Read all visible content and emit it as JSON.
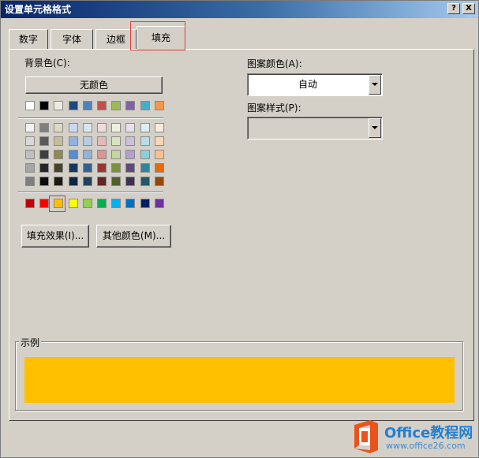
{
  "window": {
    "title": "设置单元格格式",
    "help_button": "?",
    "close_button": "X"
  },
  "tabs": [
    {
      "label": "数字",
      "active": false
    },
    {
      "label": "字体",
      "active": false
    },
    {
      "label": "边框",
      "active": false
    },
    {
      "label": "填充",
      "active": true
    }
  ],
  "background_color": {
    "label": "背景色(C):",
    "no_color_button": "无颜色",
    "theme_row": [
      "#ffffff",
      "#000000",
      "#eeece1",
      "#1f497d",
      "#4f81bd",
      "#c0504d",
      "#9bbb59",
      "#8064a2",
      "#4bacc6",
      "#f79646"
    ],
    "theme_shades": [
      [
        "#f2f2f2",
        "#7f7f7f",
        "#ddd9c3",
        "#c6d9f0",
        "#dbe5f1",
        "#f2dcdb",
        "#ebf1dd",
        "#e5e0ec",
        "#dbeef3",
        "#fdeada"
      ],
      [
        "#d8d8d8",
        "#595959",
        "#c4bd97",
        "#8db3e2",
        "#b8cce4",
        "#e5b9b7",
        "#d7e3bc",
        "#ccc1d9",
        "#b7dde8",
        "#fbd5b5"
      ],
      [
        "#bfbfbf",
        "#3f3f3f",
        "#938953",
        "#548dd4",
        "#95b3d7",
        "#d99694",
        "#c3d69b",
        "#b2a2c7",
        "#92cddc",
        "#fac08f"
      ],
      [
        "#a5a5a5",
        "#262626",
        "#494429",
        "#17365d",
        "#366092",
        "#953734",
        "#76923c",
        "#5f497a",
        "#31859b",
        "#e36c09"
      ],
      [
        "#7f7f7f",
        "#0c0c0c",
        "#1d1b10",
        "#0f243e",
        "#244061",
        "#632423",
        "#4f6128",
        "#3f3151",
        "#205867",
        "#974806"
      ]
    ],
    "standard_row": [
      "#c00000",
      "#ff0000",
      "#ffc000",
      "#ffff00",
      "#92d050",
      "#00b050",
      "#00b0f0",
      "#0070c0",
      "#002060",
      "#7030a0"
    ],
    "selected_color": "#ffc000"
  },
  "buttons": {
    "fill_effects": "填充效果(I)...",
    "more_colors": "其他颜色(M)..."
  },
  "pattern_color": {
    "label": "图案颜色(A):",
    "value": "自动"
  },
  "pattern_style": {
    "label": "图案样式(P):",
    "value": ""
  },
  "sample": {
    "label": "示例",
    "color": "#ffc000"
  },
  "watermark": {
    "brand": "Office教程网",
    "url": "www.office26.com"
  }
}
